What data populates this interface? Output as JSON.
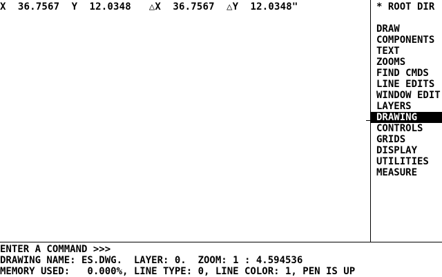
{
  "coords": {
    "x_label": "X",
    "x_value": "36.7567",
    "y_label": "Y",
    "y_value": "12.0348",
    "dx_label": "△X",
    "dx_value": "36.7567",
    "dy_label": "△Y",
    "dy_value": "12.0348\""
  },
  "menu": {
    "title": "* ROOT DIR",
    "items": [
      {
        "label": "DRAW"
      },
      {
        "label": "COMPONENTS"
      },
      {
        "label": "TEXT"
      },
      {
        "label": "ZOOMS"
      },
      {
        "label": "FIND CMDS"
      },
      {
        "label": "LINE EDITS"
      },
      {
        "label": "WINDOW EDIT"
      },
      {
        "label": "LAYERS"
      },
      {
        "label": "DRAWING"
      },
      {
        "label": "CONTROLS"
      },
      {
        "label": "GRIDS"
      },
      {
        "label": "DISPLAY"
      },
      {
        "label": "UTILITIES"
      },
      {
        "label": "MEASURE"
      }
    ],
    "selected": "DRAWING"
  },
  "status": {
    "prompt": "ENTER A COMMAND >>>",
    "drawing_info": "DRAWING NAME: ES.DWG.  LAYER: 0.  ZOOM: 1 : 4.594536",
    "memory_info": "MEMORY USED:   0.000%, LINE TYPE: 0, LINE COLOR: 1, PEN IS UP"
  }
}
